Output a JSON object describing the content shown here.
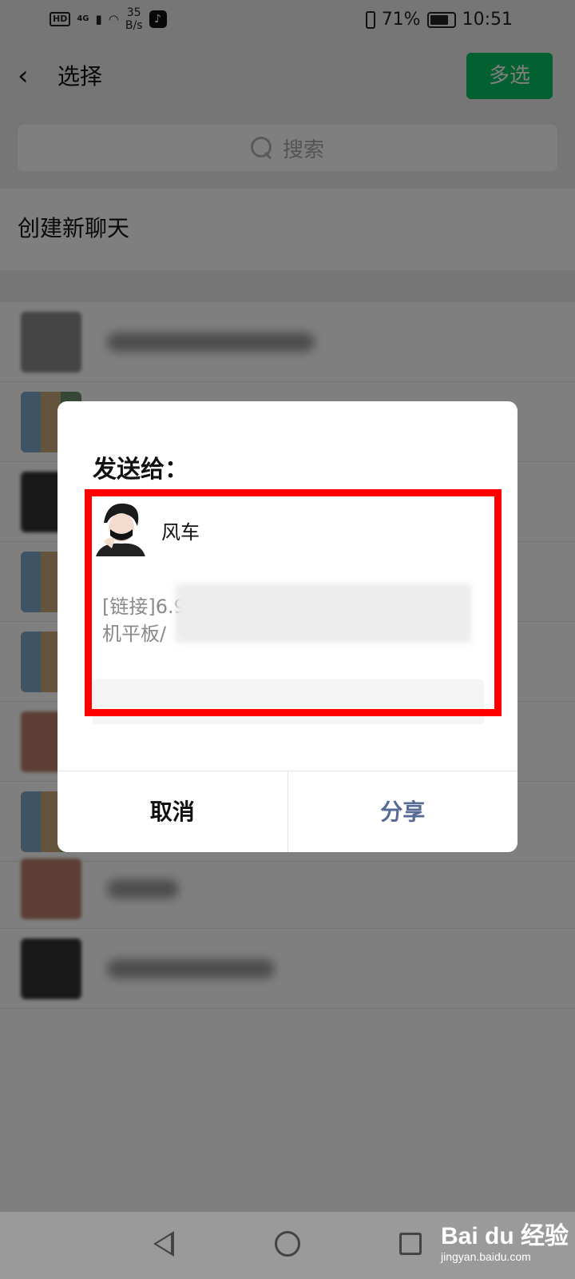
{
  "status_bar": {
    "hd": "HD",
    "network": "4G",
    "speed_value": "35",
    "speed_unit": "B/s",
    "battery": "71%",
    "time": "10:51"
  },
  "header": {
    "title": "选择",
    "multi_select_label": "多选"
  },
  "search": {
    "placeholder": "搜索"
  },
  "list": {
    "create_new_chat": "创建新聊天"
  },
  "dialog": {
    "title": "发送给：",
    "recipient_name": "风车",
    "preview_line1": "[链接]6.9",
    "preview_line2": "机平板/",
    "cancel_label": "取消",
    "share_label": "分享"
  },
  "watermark": {
    "main": "Bai du 经验",
    "sub": "jingyan.baidu.com"
  },
  "colors": {
    "accent_green": "#07c160",
    "share_blue": "#576b95",
    "highlight_red": "#ff0000"
  }
}
